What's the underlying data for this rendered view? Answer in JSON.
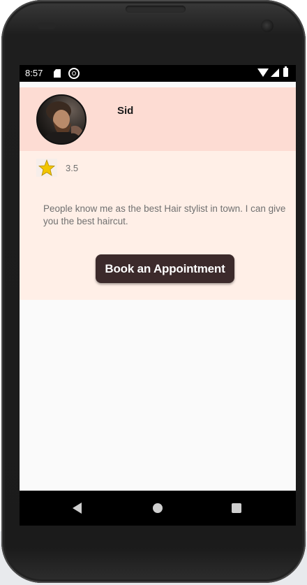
{
  "status_bar": {
    "time": "8:57",
    "icons": [
      "sd-card-icon",
      "sync-icon",
      "wifi-icon",
      "signal-icon",
      "battery-icon"
    ]
  },
  "profile": {
    "name": "Sid",
    "avatar_icon": "avatar-photo",
    "rating": "3.5",
    "rating_icon": "star-icon",
    "bio": "People know me as the best Hair stylist in town. I can give you the best haircut.",
    "book_button_label": "Book an Appointment"
  },
  "nav_bar": {
    "icons": [
      "back-icon",
      "home-icon",
      "recents-icon"
    ]
  },
  "colors": {
    "header_bg": "#fddcd3",
    "card_bg": "#ffefe7",
    "button_bg": "#3c2a2b",
    "button_text": "#ffffff",
    "star": "#f2c500"
  }
}
